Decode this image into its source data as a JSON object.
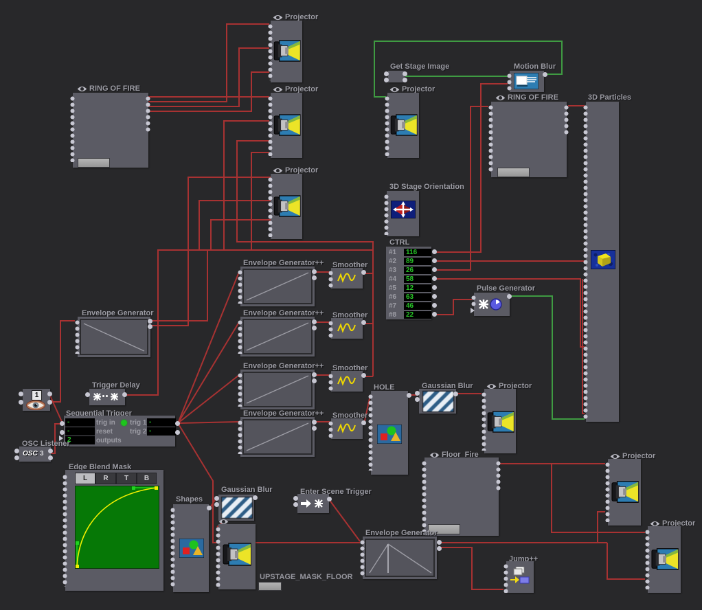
{
  "editor": {
    "background": "#28282a",
    "wire_red": "#a83232",
    "wire_green": "#3f9b42"
  },
  "labels": {
    "projector": "Projector",
    "ring_of_fire": "RING OF FIRE",
    "get_stage_image": "Get Stage Image",
    "motion_blur": "Motion Blur",
    "particles_3d": "3D Particles",
    "stage_orientation_3d": "3D Stage Orientation",
    "pulse_generator": "Pulse Generator",
    "envelope_generator_pp": "Envelope Generator++",
    "smoother": "Smoother",
    "envelope_generator": "Envelope Generator",
    "trigger_delay": "Trigger Delay",
    "sequential_trigger": "Sequential Trigger",
    "osc_listener": "OSC Listener",
    "edge_blend_mask": "Edge Blend Mask",
    "shapes": "Shapes",
    "gaussian_blur": "Gaussian Blur",
    "enter_scene_trigger": "Enter Scene Trigger",
    "hole": "HOLE",
    "floor_fire": "Floor_Fire",
    "jump_pp": "Jump++",
    "upstage_mask_floor": "UPSTAGE_MASK_FLOOR"
  },
  "ctrl": {
    "title": "CTRL",
    "channels": [
      {
        "id": "#1",
        "value": "116"
      },
      {
        "id": "#2",
        "value": "89"
      },
      {
        "id": "#3",
        "value": "26"
      },
      {
        "id": "#4",
        "value": "58"
      },
      {
        "id": "#5",
        "value": "12"
      },
      {
        "id": "#6",
        "value": "63"
      },
      {
        "id": "#7",
        "value": "46"
      },
      {
        "id": "#8",
        "value": "22"
      }
    ]
  },
  "sequential_trigger": {
    "title": "Sequential Trigger",
    "in_labels": {
      "trig_in": "trig in",
      "reset": "reset",
      "outputs": "outputs"
    },
    "out_labels": {
      "trig1": "trig 1",
      "trig2": "trig 2"
    },
    "values": {
      "trig_in": "-",
      "reset": "-",
      "outputs": "2",
      "trig1": "-",
      "trig2": "-"
    }
  },
  "osc_listener": {
    "logo": "OSC",
    "channel": "3"
  },
  "scene_jumper": {
    "value": "1"
  },
  "edge_blend_mask": {
    "tabs": [
      "L",
      "R",
      "T",
      "B"
    ],
    "active_tab": "L"
  }
}
